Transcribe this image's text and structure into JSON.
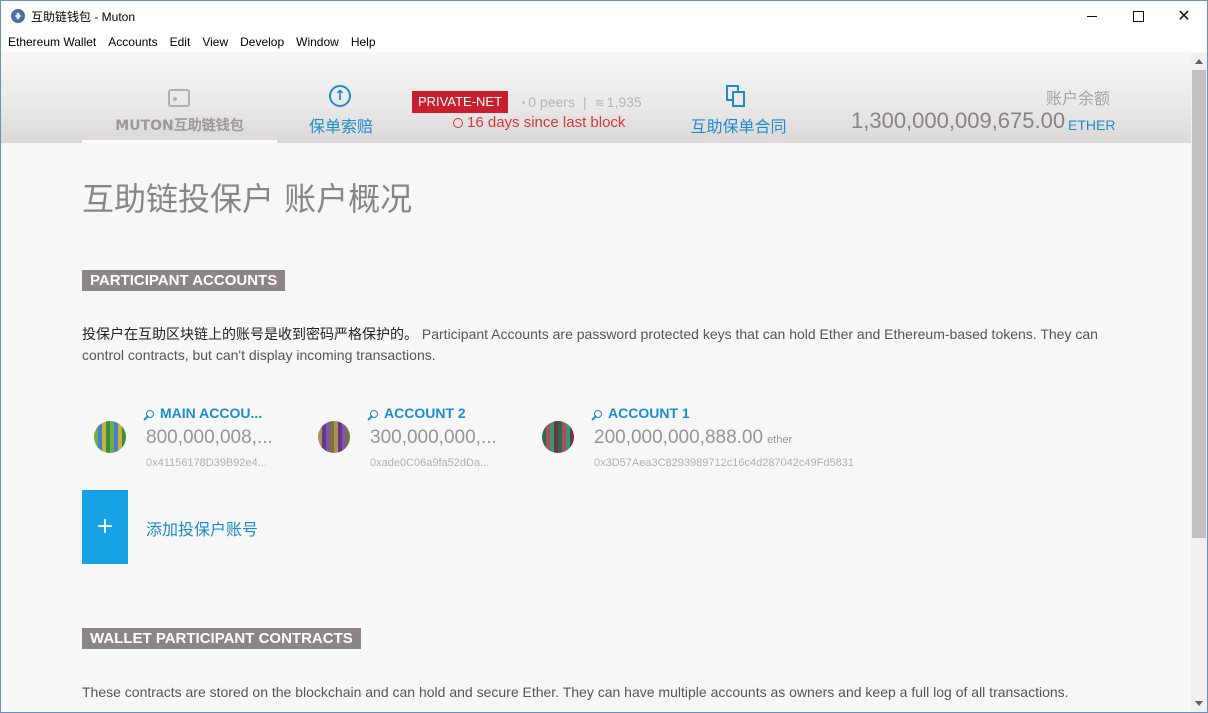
{
  "window": {
    "title": "互助链钱包 - Muton",
    "minimize": "—",
    "maximize": "☐",
    "close": "✕"
  },
  "menu": [
    "Ethereum Wallet",
    "Accounts",
    "Edit",
    "View",
    "Develop",
    "Window",
    "Help"
  ],
  "header": {
    "nav_wallets": "MUTON互助链钱包",
    "nav_send": "保单索赔",
    "network": "PRIVATE-NET",
    "peers": "0 peers",
    "separator": "|",
    "blocks": "1,935",
    "last_block": "16 days since last block",
    "nav_contracts": "互助保单合同",
    "balance_label": "账户余额",
    "balance_value": "1,300,000,009,675.00",
    "balance_unit": "ETHER"
  },
  "page": {
    "title": "互助链投保户 账户概况",
    "section_accounts": "PARTICIPANT ACCOUNTS",
    "accounts_desc_cn": "投保户在互助区块链上的账号是收到密码严格保护的。",
    "accounts_desc_en": "Participant Accounts are password protected keys that can hold Ether and Ethereum-based tokens. They can control contracts, but can't display incoming transactions.",
    "accounts": [
      {
        "name": "MAIN ACCOU...",
        "balance": "800,000,008,...",
        "unit": "",
        "address": "0x41156178D39B92e4...",
        "colors": [
          "#3a8e3a",
          "#6fae45",
          "#4a7fcf",
          "#c7b33c"
        ]
      },
      {
        "name": "ACCOUNT 2",
        "balance": "300,000,000,...",
        "unit": "",
        "address": "0xade0C06a9fa52dDa...",
        "colors": [
          "#8c4fb0",
          "#6d7a2f",
          "#b58a5a",
          "#5c3e85"
        ]
      },
      {
        "name": "ACCOUNT 1",
        "balance": "200,000,000,888.00",
        "unit": "ether",
        "address": "0x3D57Aea3C8293989712c16c4d287042c49Fd5831",
        "colors": [
          "#2d9a7a",
          "#7a2f3a",
          "#1f6f5a",
          "#b84a55"
        ]
      }
    ],
    "add_button": "+",
    "add_label": "添加投保户账号",
    "section_contracts": "WALLET PARTICIPANT CONTRACTS",
    "contracts_desc": "These contracts are stored on the blockchain and can hold and secure Ether. They can have multiple accounts as owners and keep a full log of all transactions."
  },
  "colors": {
    "accent": "#1e8ccc",
    "network_badge": "#c81f2f",
    "section_bg": "#8d8585",
    "add_button": "#17a2e5"
  }
}
